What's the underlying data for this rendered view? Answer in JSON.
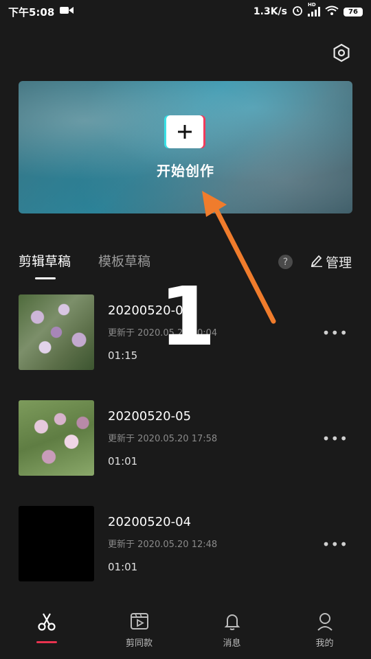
{
  "status_bar": {
    "time": "下午5:08",
    "net_speed": "1.3K/s",
    "signal_badge": "HD",
    "battery": "76"
  },
  "banner": {
    "label": "开始创作"
  },
  "tabs": [
    {
      "label": "剪辑草稿",
      "active": true
    },
    {
      "label": "模板草稿",
      "active": false
    }
  ],
  "help": "?",
  "manage_label": "管理",
  "overlay_number": "1",
  "drafts": [
    {
      "title": "20200520-06",
      "updated": "更新于 2020.05.20 20:04",
      "duration": "01:15",
      "more": "•••"
    },
    {
      "title": "20200520-05",
      "updated": "更新于 2020.05.20 17:58",
      "duration": "01:01",
      "more": "•••"
    },
    {
      "title": "20200520-04",
      "updated": "更新于 2020.05.20 12:48",
      "duration": "01:01",
      "more": "•••"
    }
  ],
  "bottom_nav": [
    {
      "label": "",
      "icon": "scissors-icon",
      "active": true
    },
    {
      "label": "剪同款",
      "icon": "template-play-icon",
      "active": false
    },
    {
      "label": "消息",
      "icon": "bell-icon",
      "active": false
    },
    {
      "label": "我的",
      "icon": "user-icon",
      "active": false
    }
  ],
  "colors": {
    "accent": "#e9334f",
    "arrow": "#f07c2c",
    "background": "#1a1a1a"
  }
}
